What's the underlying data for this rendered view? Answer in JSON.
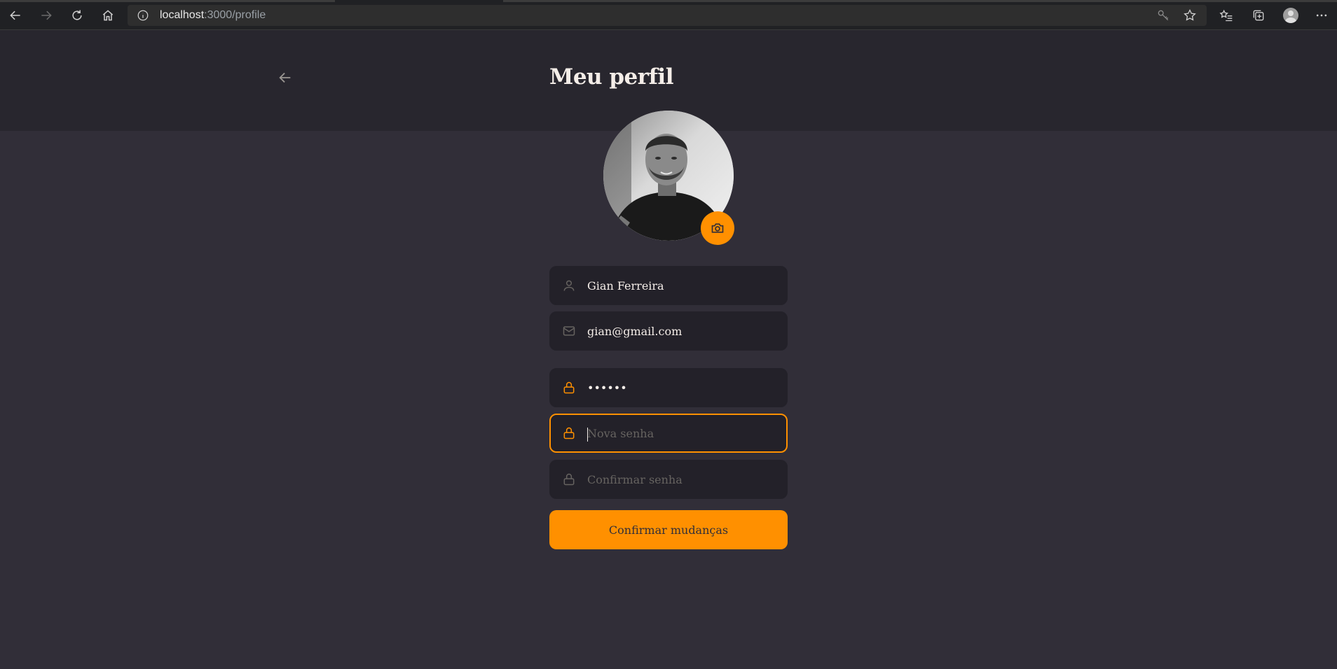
{
  "browser": {
    "url_host": "localhost",
    "url_path": ":3000/profile"
  },
  "page": {
    "title": "Meu perfil"
  },
  "form": {
    "name_value": "Gian Ferreira",
    "email_value": "gian@gmail.com",
    "old_password_value": "••••••",
    "new_password_placeholder": "Nova senha",
    "confirm_password_placeholder": "Confirmar senha",
    "submit_label": "Confirmar mudanças"
  },
  "colors": {
    "accent": "#ff9000",
    "background": "#312e38",
    "header": "#28262e",
    "input_bg": "#232129",
    "placeholder": "#666360"
  }
}
